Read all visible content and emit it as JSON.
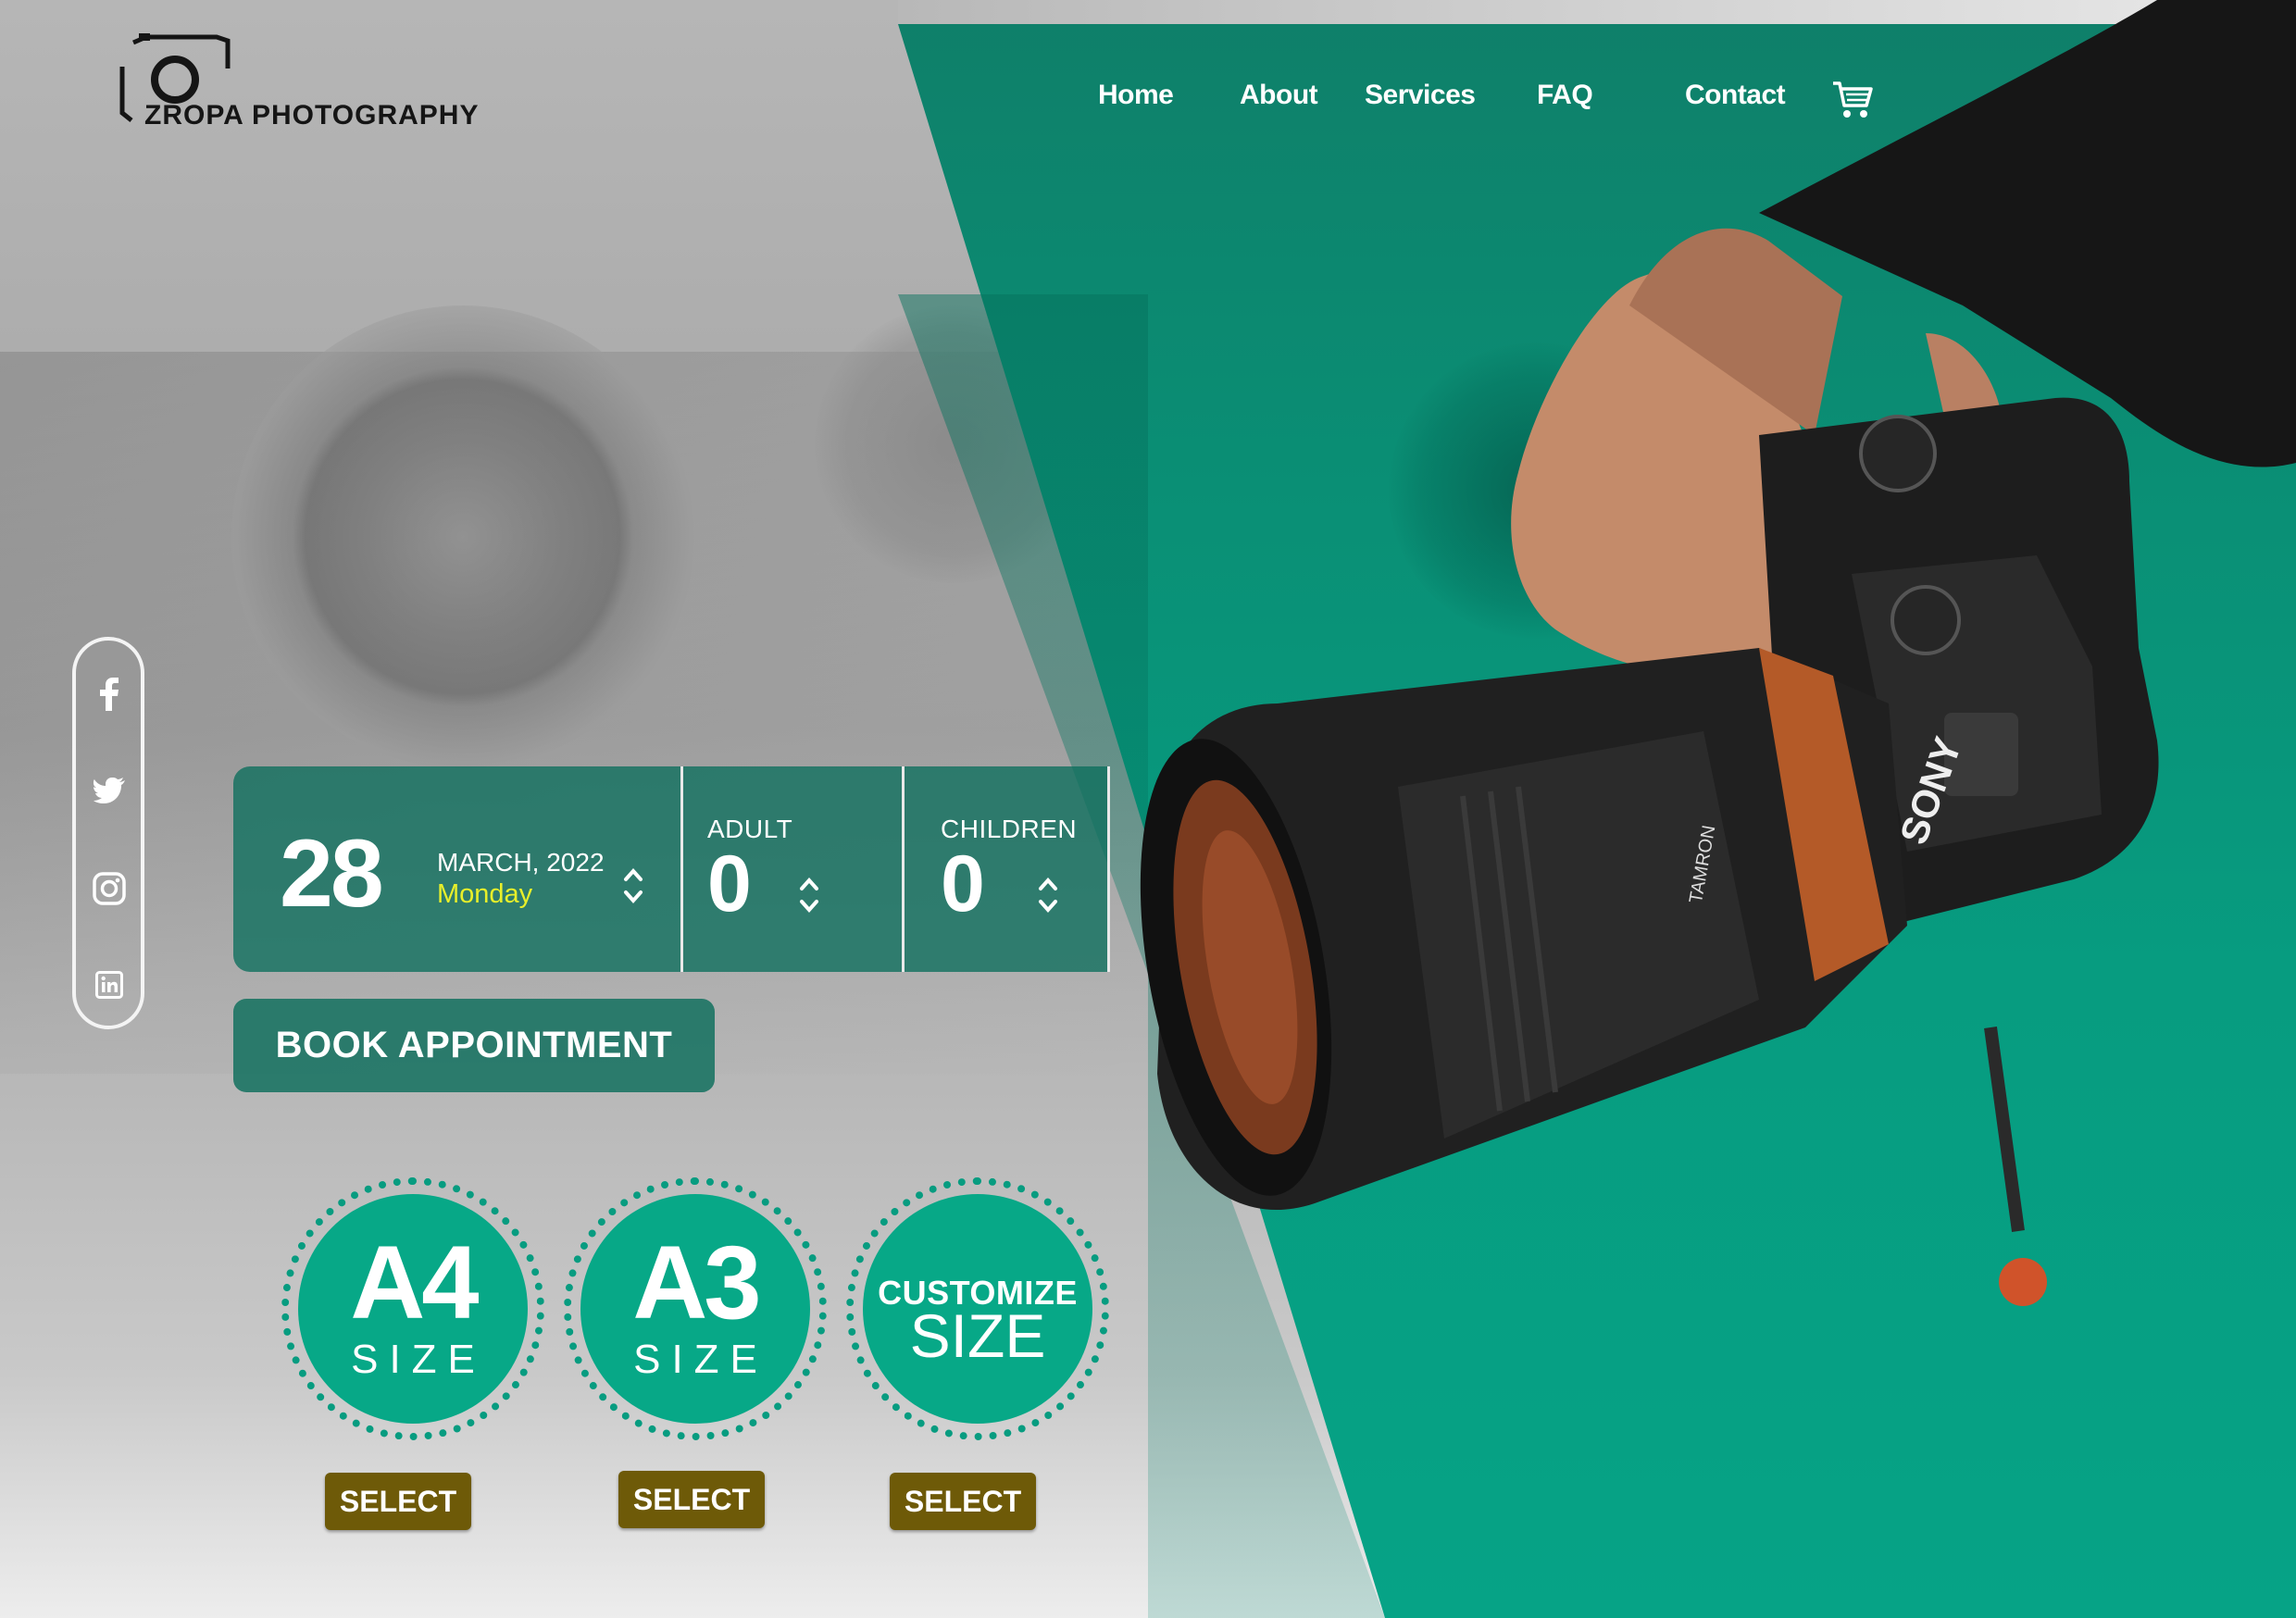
{
  "brand": {
    "name": "ZROPA PHOTOGRAPHY",
    "logo_icon": "camera-icon"
  },
  "nav": {
    "items": [
      {
        "label": "Home"
      },
      {
        "label": "About"
      },
      {
        "label": "Services"
      },
      {
        "label": "FAQ"
      },
      {
        "label": "Contact"
      }
    ],
    "cart_icon": "cart-icon"
  },
  "social": [
    "facebook-icon",
    "twitter-icon",
    "instagram-icon",
    "linkedin-icon"
  ],
  "booking": {
    "day": "28",
    "month_year": "MARCH, 2022",
    "weekday": "Monday",
    "adult_label": "ADULT",
    "adult_count": "0",
    "children_label": "CHILDREN",
    "children_count": "0"
  },
  "book_button": "BOOK APPOINTMENT",
  "sizes": [
    {
      "big": "A4",
      "small": "SIZE",
      "select": "SELECT"
    },
    {
      "big": "A3",
      "small": "SIZE",
      "select": "SELECT"
    },
    {
      "top": "CUSTOMIZE",
      "small": "SIZE",
      "select": "SELECT"
    }
  ],
  "colors": {
    "brand_green": "#079c80",
    "dark_green": "#0c6e5c",
    "select_gold": "#6e5a08",
    "weekday_yellow": "#e8ef2a"
  }
}
